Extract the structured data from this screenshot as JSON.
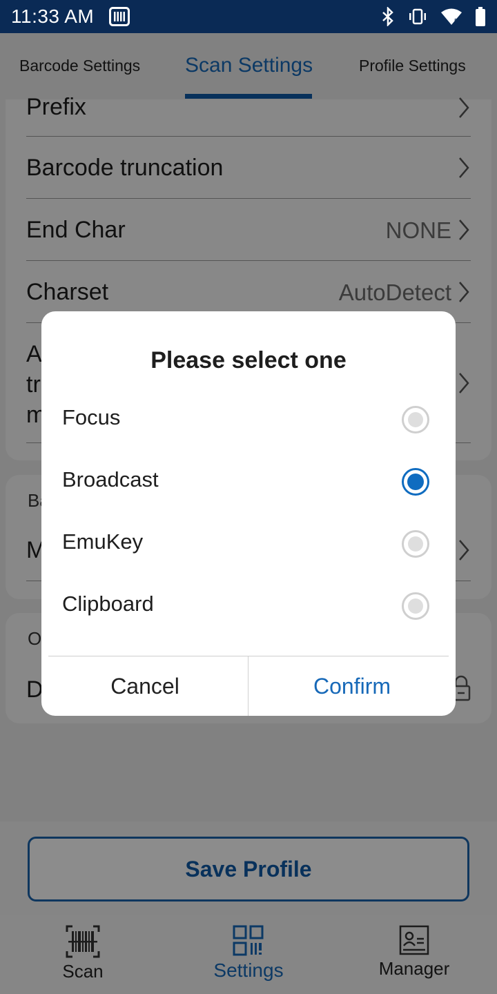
{
  "status_bar": {
    "time": "11:33 AM",
    "icons": [
      "barcode-scanner-notification-icon",
      "bluetooth-icon",
      "vibrate-icon",
      "wifi-icon",
      "battery-icon"
    ]
  },
  "tabs": [
    {
      "label": "Barcode Settings",
      "active": false
    },
    {
      "label": "Scan Settings",
      "active": true
    },
    {
      "label": "Profile Settings",
      "active": false
    }
  ],
  "settings_list": {
    "rows": [
      {
        "label": "Prefix",
        "value": ""
      },
      {
        "label": "Barcode truncation",
        "value": ""
      },
      {
        "label": "End Char",
        "value": "NONE"
      },
      {
        "label": "Charset",
        "value": "AutoDetect"
      },
      {
        "label_lines": [
          "A",
          "tr",
          "m"
        ],
        "value": ""
      }
    ],
    "section2": {
      "label": "Ba",
      "row_label": "M"
    },
    "section3": {
      "label": "Ot",
      "row_label": "D"
    }
  },
  "dialog": {
    "title": "Please select one",
    "options": [
      {
        "label": "Focus",
        "selected": false
      },
      {
        "label": "Broadcast",
        "selected": true
      },
      {
        "label": "EmuKey",
        "selected": false
      },
      {
        "label": "Clipboard",
        "selected": false
      }
    ],
    "cancel_label": "Cancel",
    "confirm_label": "Confirm"
  },
  "save_button": {
    "label": "Save Profile"
  },
  "bottom_nav": [
    {
      "label": "Scan",
      "icon": "barcode-icon",
      "active": false
    },
    {
      "label": "Settings",
      "icon": "settings-grid-icon",
      "active": true
    },
    {
      "label": "Manager",
      "icon": "profile-card-icon",
      "active": false
    }
  ],
  "colors": {
    "status_bar": "#0a2a55",
    "accent": "#1769b8",
    "selected_radio": "#0f6cc0"
  }
}
